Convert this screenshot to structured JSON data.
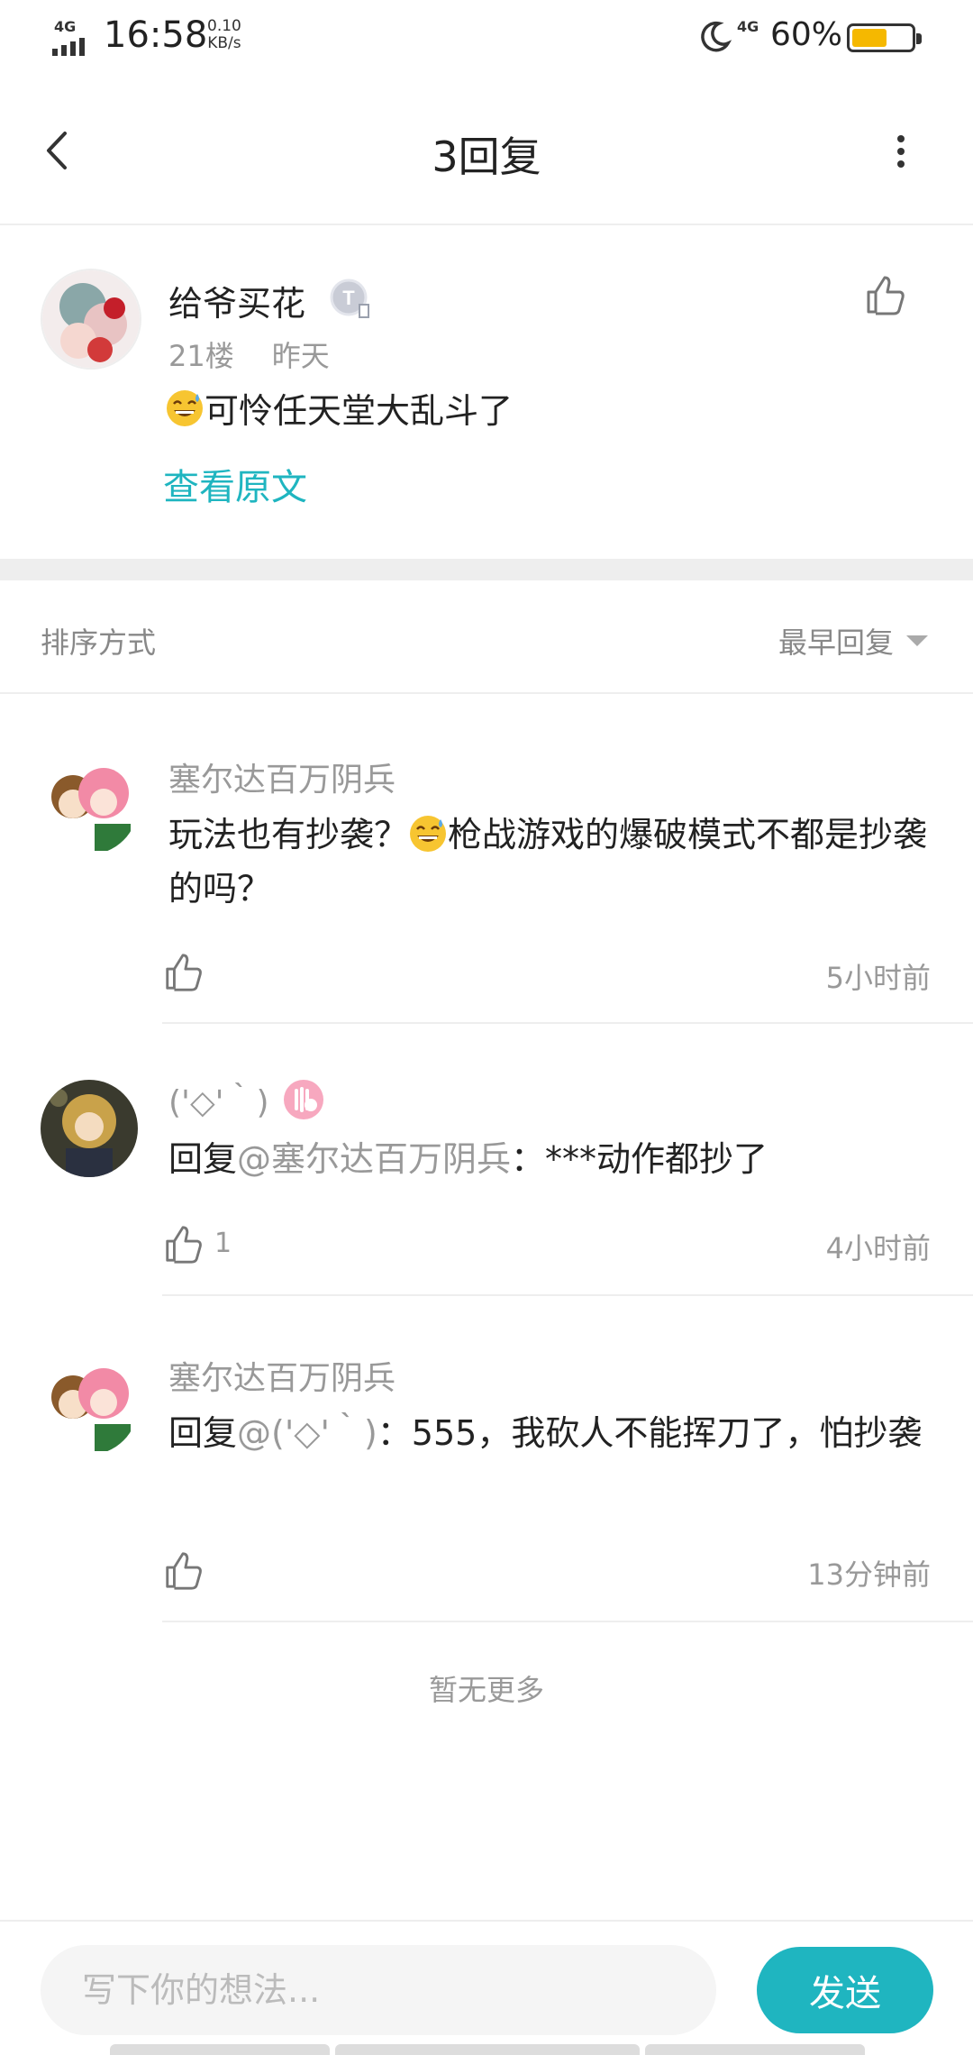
{
  "status_bar": {
    "network": "4G",
    "time": "16:58",
    "speed_value": "0.10",
    "speed_unit": "KB/s",
    "network2": "4G",
    "battery_pct": "60%",
    "battery_level": 0.6,
    "battery_color": "#f5b800"
  },
  "header": {
    "title": "3回复"
  },
  "post": {
    "username": "给爷买花",
    "floor": "21楼",
    "time": "昨天",
    "content": "可怜任天堂大乱斗了",
    "view_original": "查看原文"
  },
  "sort": {
    "label": "排序方式",
    "selected": "最早回复"
  },
  "replies": [
    {
      "username": "塞尔达百万阴兵",
      "text_before": "玩法也有抄袭？",
      "text_after": "枪战游戏的爆破模式不都是抄袭的吗？",
      "time": "5小时前"
    },
    {
      "username": "('◇'｀)",
      "reply_prefix": "回复",
      "mention": "@塞尔达百万阴兵",
      "text": "：***动作都抄了",
      "likes": "1",
      "time": "4小时前"
    },
    {
      "username": "塞尔达百万阴兵",
      "reply_prefix": "回复",
      "mention": "@('◇'｀)",
      "text": "：555，我砍人不能挥刀了，怕抄袭",
      "time": "13分钟前"
    }
  ],
  "no_more": "暂无更多",
  "composer": {
    "placeholder": "写下你的想法...",
    "send_label": "发送"
  },
  "colors": {
    "accent": "#1fb5c0",
    "muted_text": "#999999"
  }
}
